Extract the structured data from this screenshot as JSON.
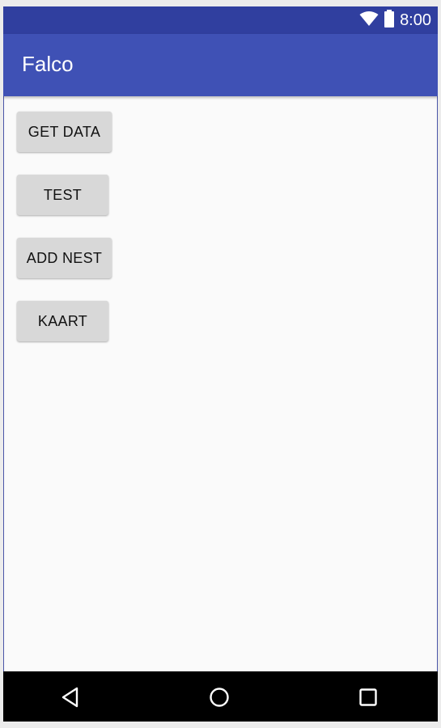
{
  "status_bar": {
    "time": "8:00",
    "icons": [
      "wifi-icon",
      "battery-icon"
    ]
  },
  "app_bar": {
    "title": "Falco"
  },
  "buttons": [
    {
      "label": "GET DATA"
    },
    {
      "label": "TEST"
    },
    {
      "label": "ADD NEST"
    },
    {
      "label": "KAART"
    }
  ],
  "nav_bar": {
    "icons": [
      "back-icon",
      "home-icon",
      "recents-icon"
    ]
  },
  "colors": {
    "status_bar": "#303f9f",
    "app_bar": "#3f51b5",
    "background": "#fafafa",
    "button": "#d8d8d8",
    "nav_bar": "#000000"
  }
}
